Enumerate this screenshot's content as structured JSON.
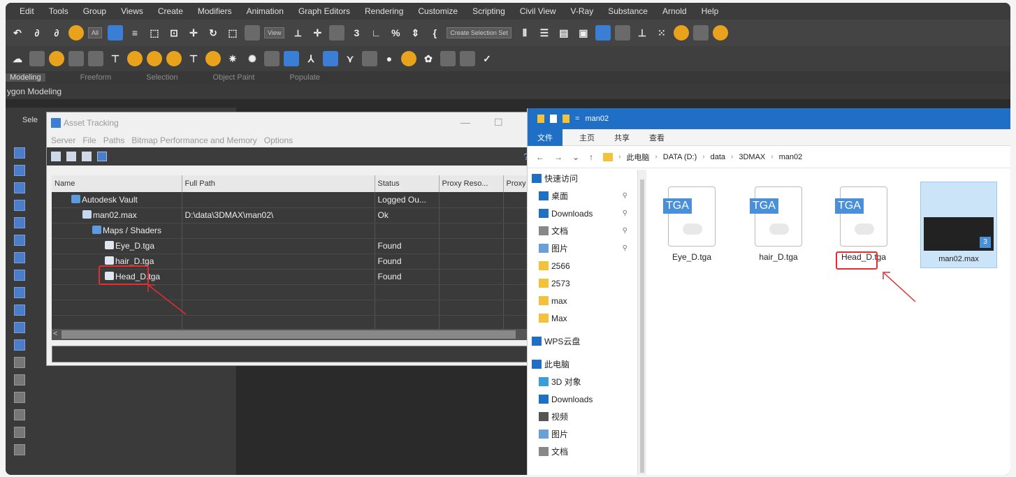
{
  "menu": [
    "Edit",
    "Tools",
    "Group",
    "Views",
    "Create",
    "Modifiers",
    "Animation",
    "Graph Editors",
    "Rendering",
    "Customize",
    "Scripting",
    "Civil View",
    "V-Ray",
    "Substance",
    "Arnold",
    "Help"
  ],
  "toolbar": {
    "filter_value": "All",
    "view_value": "View",
    "selection_set": "Create Selection Set"
  },
  "ribbon": [
    "Modeling",
    "Freeform",
    "Selection",
    "Object Paint",
    "Populate"
  ],
  "sub_ribbon": "ygon Modeling",
  "left_panel": {
    "label": "Sele"
  },
  "asset_window": {
    "title": "Asset Tracking",
    "menu": [
      "Server",
      "File",
      "Paths",
      "Bitmap Performance and Memory",
      "Options"
    ],
    "columns": [
      "Name",
      "Full Path",
      "Status",
      "Proxy Reso...",
      "Proxy"
    ],
    "rows": [
      {
        "name": "Autodesk Vault",
        "path": "",
        "status": "Logged Ou...",
        "icon": "vault-icon"
      },
      {
        "name": "man02.max",
        "path": "D:\\data\\3DMAX\\man02\\",
        "status": "Ok",
        "icon": "max-file-icon"
      },
      {
        "name": "Maps / Shaders",
        "path": "",
        "status": "",
        "icon": "maps-icon"
      },
      {
        "name": "Eye_D.tga",
        "path": "",
        "status": "Found",
        "icon": "tga-icon"
      },
      {
        "name": "hair_D.tga",
        "path": "",
        "status": "Found",
        "icon": "tga-icon"
      },
      {
        "name": "Head_D.tga",
        "path": "",
        "status": "Found",
        "icon": "tga-icon"
      }
    ]
  },
  "explorer": {
    "title": "man02",
    "tabs": [
      "文件",
      "主页",
      "共享",
      "查看"
    ],
    "breadcrumb": [
      "此电脑",
      "DATA (D:)",
      "data",
      "3DMAX",
      "man02"
    ],
    "nav": [
      {
        "label": "快速访问",
        "icon": "star-icon",
        "pinned": false
      },
      {
        "label": "桌面",
        "icon": "desktop-icon",
        "pinned": true
      },
      {
        "label": "Downloads",
        "icon": "download-icon",
        "pinned": true
      },
      {
        "label": "文档",
        "icon": "document-icon",
        "pinned": true
      },
      {
        "label": "图片",
        "icon": "pictures-icon",
        "pinned": true
      },
      {
        "label": "2566",
        "icon": "folder-icon",
        "pinned": false
      },
      {
        "label": "2573",
        "icon": "folder-icon",
        "pinned": false
      },
      {
        "label": "max",
        "icon": "folder-icon",
        "pinned": false
      },
      {
        "label": "Max",
        "icon": "folder-icon",
        "pinned": false
      },
      {
        "label": "WPS云盘",
        "icon": "cloud-icon",
        "pinned": false
      },
      {
        "label": "此电脑",
        "icon": "computer-icon",
        "pinned": false
      },
      {
        "label": "3D 对象",
        "icon": "3d-objects-icon",
        "pinned": false
      },
      {
        "label": "Downloads",
        "icon": "download-icon",
        "pinned": false
      },
      {
        "label": "视频",
        "icon": "video-icon",
        "pinned": false
      },
      {
        "label": "图片",
        "icon": "pictures-icon",
        "pinned": false
      },
      {
        "label": "文档",
        "icon": "document-icon",
        "pinned": false
      }
    ],
    "files": [
      {
        "name": "Eye_D.tga",
        "type": "TGA"
      },
      {
        "name": "hair_D.tga",
        "type": "TGA"
      },
      {
        "name": "Head_D.tga",
        "type": "TGA"
      },
      {
        "name": "man02.max",
        "type": "max"
      }
    ],
    "max_badge": "3"
  },
  "colors": {
    "highlight": "#e03030",
    "accent": "#1f6fc7"
  }
}
